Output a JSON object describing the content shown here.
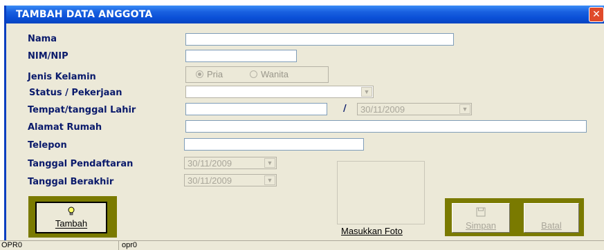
{
  "window": {
    "title": "TAMBAH DATA ANGGOTA",
    "close_glyph": "✕"
  },
  "form": {
    "nama_label": "Nama",
    "nim_label": "NIM/NIP",
    "gender_label": "Jenis Kelamin",
    "gender_options": [
      {
        "label": "Pria",
        "checked": true
      },
      {
        "label": "Wanita",
        "checked": false
      }
    ],
    "status_label": "Status / Pekerjaan",
    "ttl_label": "Tempat/tanggal Lahir",
    "ttl_separator": "/",
    "birth_date": "30/11/2009",
    "alamat_label": "Alamat Rumah",
    "telepon_label": "Telepon",
    "tgl_daftar_label": "Tanggal Pendaftaran",
    "tgl_daftar_value": "30/11/2009",
    "tgl_akhir_label": "Tanggal Berakhir",
    "tgl_akhir_value": "30/11/2009"
  },
  "photo": {
    "link_label": "Masukkan Foto"
  },
  "buttons": {
    "tambah_label": "Tambah",
    "simpan_label": "Simpan",
    "batal_label": "Batal"
  },
  "statusbar": {
    "cell1": "OPR0",
    "cell2": "opr0"
  },
  "colors": {
    "title_bar": "#0a4fd6",
    "label_text": "#0a1a6b",
    "button_frame": "#7a7a00",
    "close_button": "#e04a2a"
  }
}
